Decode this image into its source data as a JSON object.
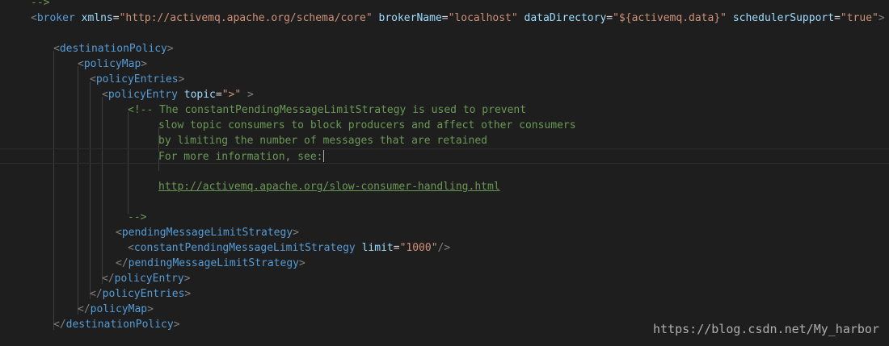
{
  "editor": {
    "lines": [
      {
        "indent": 38,
        "tokens": [
          {
            "c": "c",
            "t": "-->"
          }
        ]
      },
      {
        "indent": 38,
        "tokens": [
          {
            "c": "p",
            "t": "<"
          },
          {
            "c": "t",
            "t": "broker"
          },
          {
            "c": "",
            "t": " "
          },
          {
            "c": "a",
            "t": "xmlns"
          },
          {
            "c": "",
            "t": "="
          },
          {
            "c": "s",
            "t": "\"http://activemq.apache.org/schema/core\""
          },
          {
            "c": "",
            "t": " "
          },
          {
            "c": "a",
            "t": "brokerName"
          },
          {
            "c": "",
            "t": "="
          },
          {
            "c": "s",
            "t": "\"localhost\""
          },
          {
            "c": "",
            "t": " "
          },
          {
            "c": "a",
            "t": "dataDirectory"
          },
          {
            "c": "",
            "t": "="
          },
          {
            "c": "s",
            "t": "\"${activemq.data}\""
          },
          {
            "c": "",
            "t": " "
          },
          {
            "c": "a",
            "t": "schedulerSupport"
          },
          {
            "c": "",
            "t": "="
          },
          {
            "c": "s",
            "t": "\"true\""
          },
          {
            "c": "p",
            "t": ">"
          }
        ]
      },
      {
        "indent": 0,
        "tokens": []
      },
      {
        "indent": 66,
        "tokens": [
          {
            "c": "p",
            "t": "<"
          },
          {
            "c": "t",
            "t": "destinationPolicy"
          },
          {
            "c": "p",
            "t": ">"
          }
        ]
      },
      {
        "indent": 96,
        "tokens": [
          {
            "c": "p",
            "t": "<"
          },
          {
            "c": "t",
            "t": "policyMap"
          },
          {
            "c": "p",
            "t": ">"
          }
        ]
      },
      {
        "indent": 111,
        "tokens": [
          {
            "c": "p",
            "t": "<"
          },
          {
            "c": "t",
            "t": "policyEntries"
          },
          {
            "c": "p",
            "t": ">"
          }
        ]
      },
      {
        "indent": 126,
        "tokens": [
          {
            "c": "p",
            "t": "<"
          },
          {
            "c": "t",
            "t": "policyEntry"
          },
          {
            "c": "",
            "t": " "
          },
          {
            "c": "a",
            "t": "topic"
          },
          {
            "c": "",
            "t": "="
          },
          {
            "c": "s",
            "t": "\">\""
          },
          {
            "c": "",
            "t": " "
          },
          {
            "c": "p",
            "t": ">"
          }
        ]
      },
      {
        "indent": 158,
        "tokens": [
          {
            "c": "c",
            "t": "<!-- The constantPendingMessageLimitStrategy is used to prevent"
          }
        ]
      },
      {
        "indent": 196,
        "tokens": [
          {
            "c": "c",
            "t": "slow topic consumers to block producers and affect other consumers"
          }
        ]
      },
      {
        "indent": 196,
        "tokens": [
          {
            "c": "c",
            "t": "by limiting the number of messages that are retained"
          }
        ]
      },
      {
        "indent": 196,
        "current": true,
        "tokens": [
          {
            "c": "c",
            "t": "For more information, see:"
          }
        ],
        "cursor": true
      },
      {
        "indent": 0,
        "tokens": []
      },
      {
        "indent": 196,
        "tokens": [
          {
            "c": "u",
            "t": "http://activemq.apache.org/slow-consumer-handling.html"
          }
        ]
      },
      {
        "indent": 0,
        "tokens": []
      },
      {
        "indent": 158,
        "tokens": [
          {
            "c": "c",
            "t": "-->"
          }
        ]
      },
      {
        "indent": 143,
        "tokens": [
          {
            "c": "p",
            "t": "<"
          },
          {
            "c": "t",
            "t": "pendingMessageLimitStrategy"
          },
          {
            "c": "p",
            "t": ">"
          }
        ]
      },
      {
        "indent": 158,
        "tokens": [
          {
            "c": "p",
            "t": "<"
          },
          {
            "c": "t",
            "t": "constantPendingMessageLimitStrategy"
          },
          {
            "c": "",
            "t": " "
          },
          {
            "c": "a",
            "t": "limit"
          },
          {
            "c": "",
            "t": "="
          },
          {
            "c": "s",
            "t": "\"1000\""
          },
          {
            "c": "p",
            "t": "/>"
          }
        ]
      },
      {
        "indent": 143,
        "tokens": [
          {
            "c": "p",
            "t": "</"
          },
          {
            "c": "t",
            "t": "pendingMessageLimitStrategy"
          },
          {
            "c": "p",
            "t": ">"
          }
        ]
      },
      {
        "indent": 126,
        "tokens": [
          {
            "c": "p",
            "t": "</"
          },
          {
            "c": "t",
            "t": "policyEntry"
          },
          {
            "c": "p",
            "t": ">"
          }
        ]
      },
      {
        "indent": 111,
        "tokens": [
          {
            "c": "p",
            "t": "</"
          },
          {
            "c": "t",
            "t": "policyEntries"
          },
          {
            "c": "p",
            "t": ">"
          }
        ]
      },
      {
        "indent": 96,
        "tokens": [
          {
            "c": "p",
            "t": "</"
          },
          {
            "c": "t",
            "t": "policyMap"
          },
          {
            "c": "p",
            "t": ">"
          }
        ]
      },
      {
        "indent": 66,
        "tokens": [
          {
            "c": "p",
            "t": "</"
          },
          {
            "c": "t",
            "t": "destinationPolicy"
          },
          {
            "c": "p",
            "t": ">"
          }
        ]
      }
    ]
  },
  "watermark": "https://blog.csdn.net/My_harbor",
  "colors": {
    "background": "#1e1e1e",
    "tag": "#569cd6",
    "attribute": "#9cdcfe",
    "string": "#ce9178",
    "comment": "#6a9955",
    "punctuation": "#808080"
  }
}
